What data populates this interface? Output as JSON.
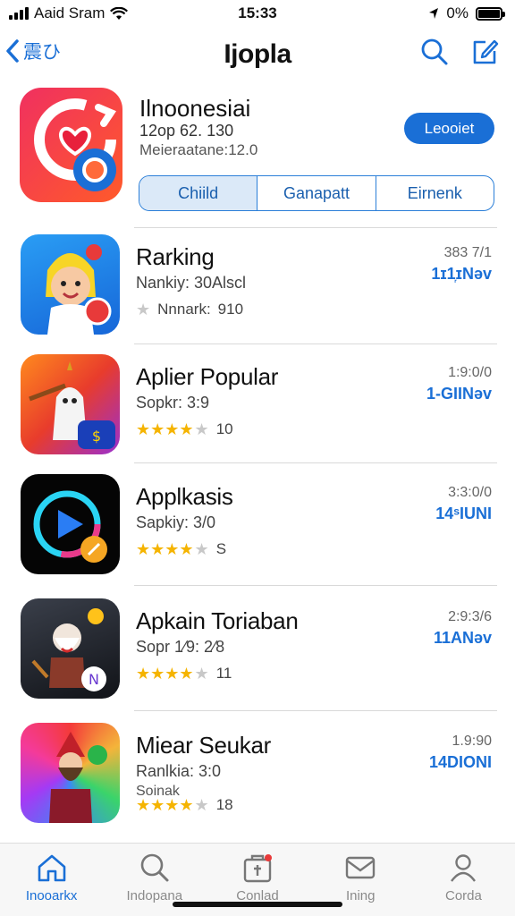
{
  "status_bar": {
    "carrier": "Aaid Sram",
    "time": "15:33",
    "battery": "0%"
  },
  "nav": {
    "back_label": "震ひ",
    "title": "Ijopla"
  },
  "featured": {
    "title": "Ilnoonesiai",
    "meta1": "12op 62. 130",
    "meta2": "Meieraatane:12.0",
    "get_label": "Leooiet",
    "segments": [
      "Chiild",
      "Ganapatt",
      "Eirnenk"
    ]
  },
  "apps": [
    {
      "name": "Rarking",
      "sub": "Nankiy: 30Alscl",
      "sub2": "",
      "stars": 0,
      "rating_prefix": "Nnnark:",
      "rating": "910",
      "right_top": "383 7/1",
      "right_bot": "1ɪ1᷊ɪNəv"
    },
    {
      "name": "Aplier Popular",
      "sub": "Sopkr: 3:9",
      "sub2": "",
      "stars": 4,
      "rating_prefix": "",
      "rating": "10",
      "right_top": "1:9:0/0",
      "right_bot": "1-GIINəv"
    },
    {
      "name": "Applkasis",
      "sub": "Sapkiy: 3/0",
      "sub2": "",
      "stars": 4,
      "rating_prefix": "",
      "rating": "S",
      "right_top": "3:3:0/0",
      "right_bot": "14ˢIUNI"
    },
    {
      "name": "Apkain Toriaban",
      "sub": "Sopr 1⁄9: 2⁄8",
      "sub2": "",
      "stars": 4,
      "rating_prefix": "",
      "rating": "11",
      "right_top": "2:9:3/6",
      "right_bot": "11ANəv"
    },
    {
      "name": "Miear Seukar",
      "sub": "Ranlkia: 3:0",
      "sub2": "Soinak",
      "stars": 4,
      "rating_prefix": "",
      "rating": "18",
      "right_top": "1.9:90",
      "right_bot": "14DIONI"
    }
  ],
  "tabs": [
    {
      "label": "Inooarkx",
      "icon": "home-icon",
      "active": true
    },
    {
      "label": "Indopana",
      "icon": "search-icon",
      "active": false
    },
    {
      "label": "Conlad",
      "icon": "store-icon",
      "active": false
    },
    {
      "label": "Ining",
      "icon": "mail-icon",
      "active": false
    },
    {
      "label": "Corda",
      "icon": "person-icon",
      "active": false
    }
  ],
  "colors": {
    "accent": "#1a6fd6",
    "star": "#f5b400"
  }
}
